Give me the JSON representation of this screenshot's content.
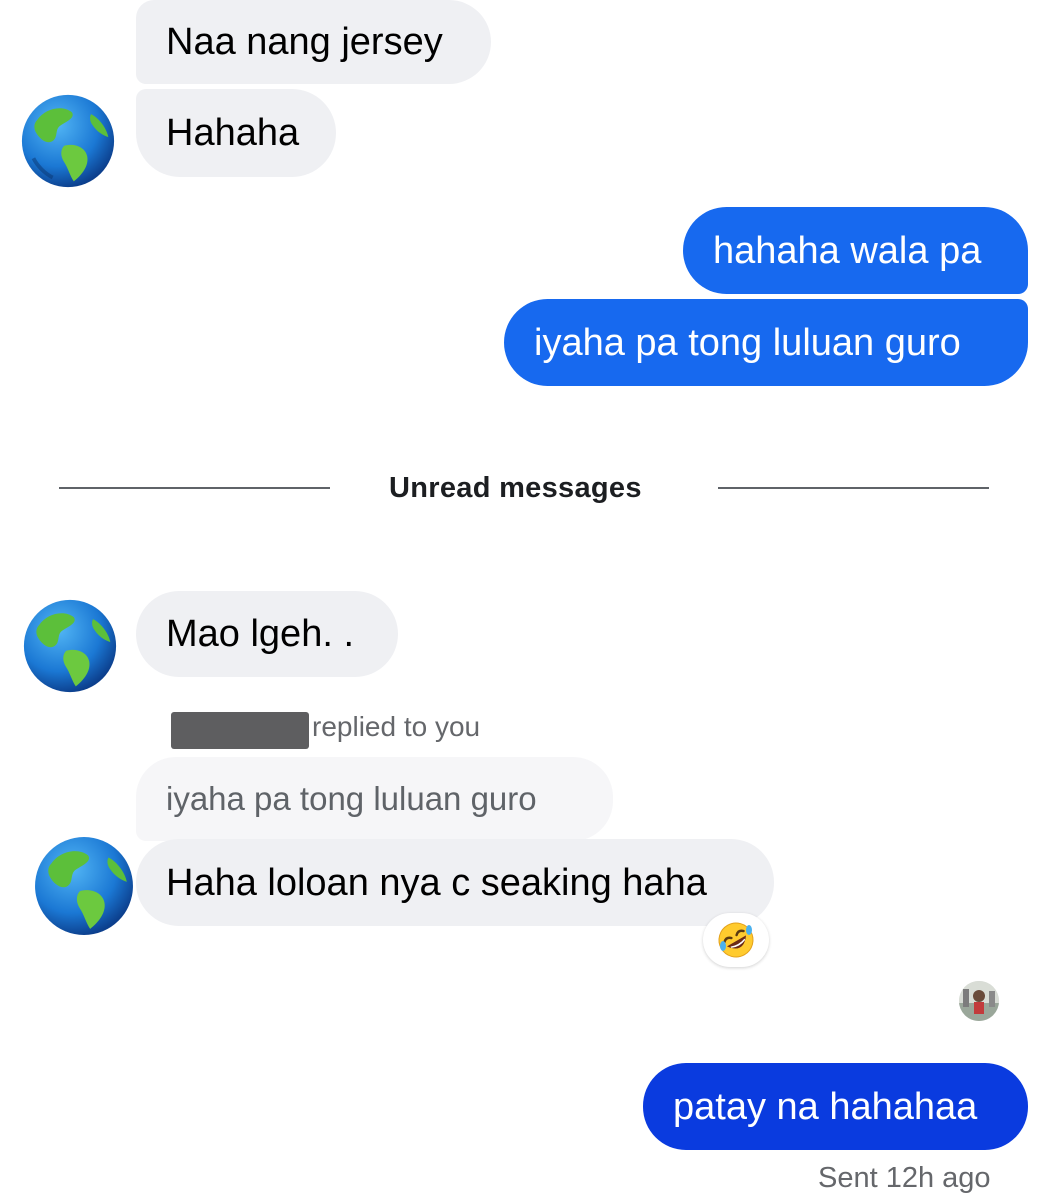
{
  "messages": {
    "m1": "Naa nang jersey",
    "m2": "Hahaha",
    "m3": "hahaha wala pa",
    "m4": "iyaha pa tong luluan guro",
    "m5": "Mao lgeh. .",
    "m6": "Haha loloan nya c seaking haha",
    "m7": "patay na hahahaa"
  },
  "divider": {
    "label": "Unread messages"
  },
  "reply": {
    "meta": "replied to you",
    "quoted": "iyaha pa tong luluan guro"
  },
  "reaction": {
    "icon": "rolling-on-floor-laughing-emoji"
  },
  "status": {
    "text": "Sent 12h ago"
  },
  "colors": {
    "incoming_bubble": "#eff0f3",
    "outgoing_bubble": "#1769ef",
    "outgoing_bubble_last": "#0a3bdf",
    "divider_line": "#5f6368",
    "secondary_text": "#65676b"
  },
  "icons": {
    "avatar": "globe-americas-icon",
    "seen": "seen-avatar-icon"
  }
}
